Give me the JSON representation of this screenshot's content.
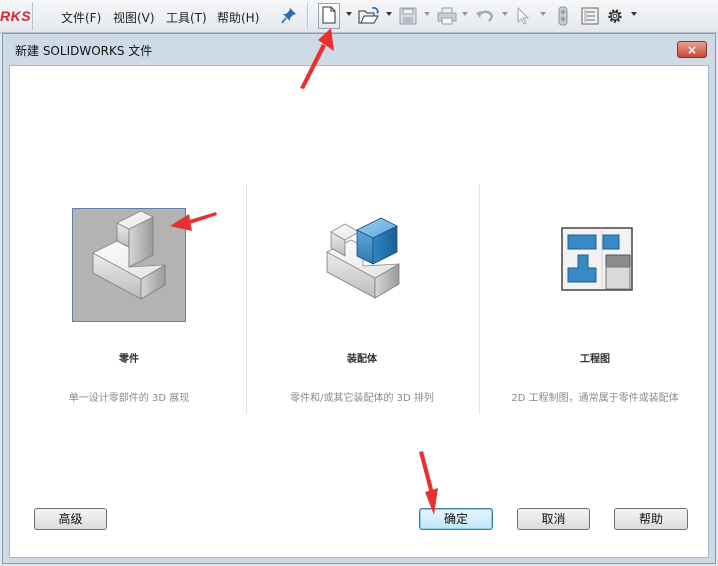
{
  "app": {
    "brand_text": "RKS"
  },
  "menu": {
    "file": "文件(F)",
    "view": "视图(V)",
    "tools": "工具(T)",
    "help": "帮助(H)"
  },
  "toolbar": {
    "icons": [
      "pin-icon",
      "new-document-icon",
      "open-folder-icon",
      "save-icon",
      "print-icon",
      "undo-icon",
      "select-cursor-icon",
      "traffic-light-icon",
      "file-properties-icon",
      "options-gear-icon"
    ]
  },
  "dialog": {
    "title": "新建 SOLIDWORKS 文件",
    "close_label": "×",
    "options": [
      {
        "label": "零件",
        "description": "单一设计零部件的 3D 展现",
        "selected": true
      },
      {
        "label": "装配体",
        "description": "零件和/或其它装配体的 3D 排列",
        "selected": false
      },
      {
        "label": "工程图",
        "description": "2D 工程制图，通常属于零件或装配体",
        "selected": false
      }
    ],
    "buttons": {
      "advanced": "高级",
      "ok": "确定",
      "cancel": "取消",
      "help": "帮助"
    }
  },
  "colors": {
    "arrow": "#e8312e",
    "assembly_blue": "#2f86c6",
    "tile_selected": "#b3b3b3"
  }
}
